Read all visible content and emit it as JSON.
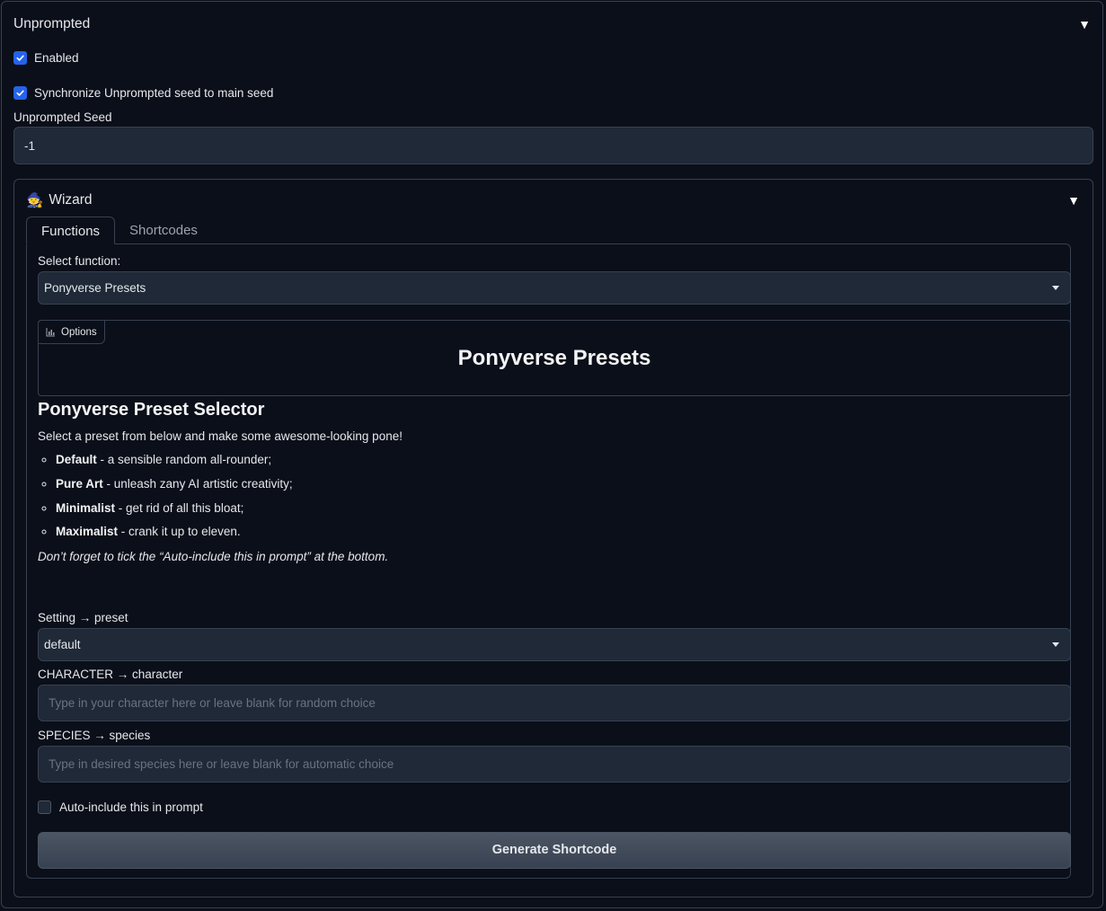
{
  "accordion": {
    "title": "Unprompted",
    "enabled_label": "Enabled",
    "sync_label": "Synchronize Unprompted seed to main seed",
    "seed_label": "Unprompted Seed",
    "seed_value": "-1"
  },
  "wizard": {
    "icon": "🧙",
    "title": "Wizard",
    "tabs": [
      {
        "label": "Functions"
      },
      {
        "label": "Shortcodes"
      }
    ],
    "select_function_label": "Select function:",
    "select_function_value": "Ponyverse Presets",
    "options_tag": "Options",
    "options_title": "Ponyverse Presets",
    "heading": "Ponyverse Preset Selector",
    "intro": "Select a preset from below and make some awesome-looking pone!",
    "presets": [
      {
        "name": "Default",
        "desc": " - a sensible random all-rounder;"
      },
      {
        "name": "Pure Art",
        "desc": " - unleash zany AI artistic creativity;"
      },
      {
        "name": "Minimalist",
        "desc": " - get rid of all this bloat;"
      },
      {
        "name": "Maximalist",
        "desc": " - crank it up to eleven."
      }
    ],
    "note": "Don’t forget to tick the “Auto-include this in prompt” at the bottom.",
    "setting_label": "Setting → preset",
    "setting_value": "default",
    "character_label": "CHARACTER → character",
    "character_placeholder": "Type in your character here or leave blank for random choice",
    "species_label": "SPECIES → species",
    "species_placeholder": "Type in desired species here or leave blank for automatic choice",
    "auto_include_label": "Auto-include this in prompt",
    "generate_label": "Generate Shortcode"
  }
}
